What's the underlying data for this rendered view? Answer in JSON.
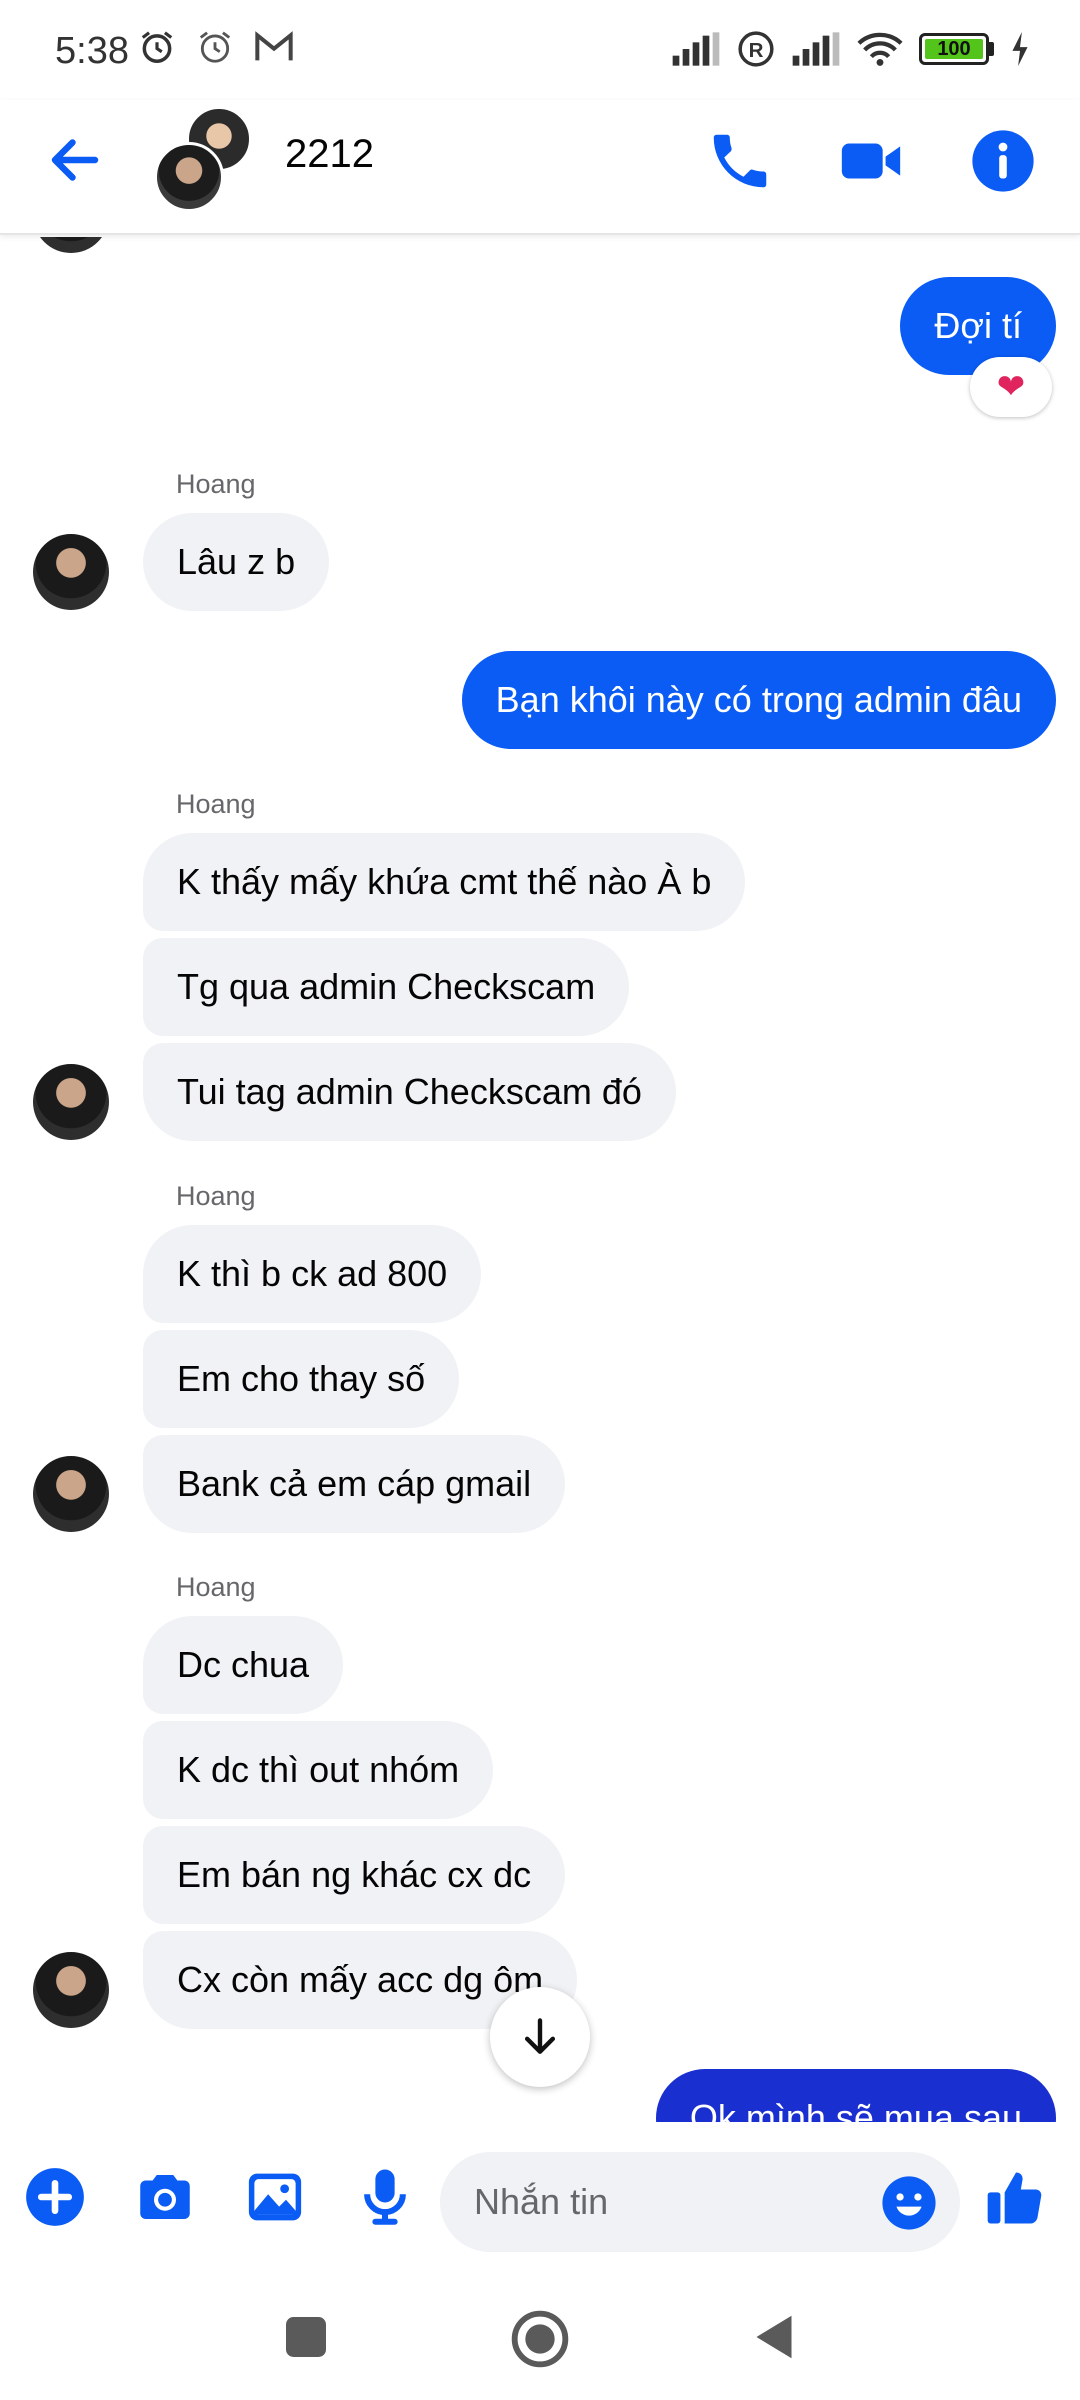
{
  "status_bar": {
    "time": "5:38",
    "battery": "100",
    "left_icons": [
      "alarm-icon",
      "alarm-icon",
      "gmail-icon"
    ],
    "right_icons": [
      "signal-icon",
      "roaming-icon",
      "signal-icon",
      "wifi-icon",
      "battery-icon",
      "charging-icon"
    ]
  },
  "header": {
    "title": "2212",
    "icons": [
      "back-arrow-icon",
      "phone-icon",
      "video-icon",
      "info-icon"
    ],
    "accent": "#0a5cf5"
  },
  "messages": {
    "m1": "Đợi tí",
    "m1_reaction": "❤",
    "sender_1": "Hoang",
    "m2": "Lâu z b",
    "m3": "Bạn khôi này có trong admin đâu",
    "sender_2": "Hoang",
    "m4": "K thấy mấy khứa cmt thế nào À b",
    "m5": "Tg qua admin Checkscam",
    "m6": "Tui tag admin Checkscam đó",
    "sender_3": "Hoang",
    "m7": "K thì b ck ad 800",
    "m8": "Em cho thay số",
    "m9": "Bank cả em cáp gmail",
    "sender_4": "Hoang",
    "m10": "Dc chua",
    "m11": "K dc thì out nhóm",
    "m12": "Em bán ng khác cx dc",
    "m13": "Cx còn mấy acc dg ôm",
    "m14": "Ok mình sẽ mua sau"
  },
  "composer": {
    "placeholder": "Nhắn tin",
    "icons": [
      "plus-icon",
      "camera-icon",
      "image-icon",
      "microphone-icon",
      "emoji-icon",
      "thumbs-up-icon"
    ]
  },
  "nav": {
    "icons": [
      "recents-icon",
      "home-icon",
      "back-icon"
    ]
  }
}
